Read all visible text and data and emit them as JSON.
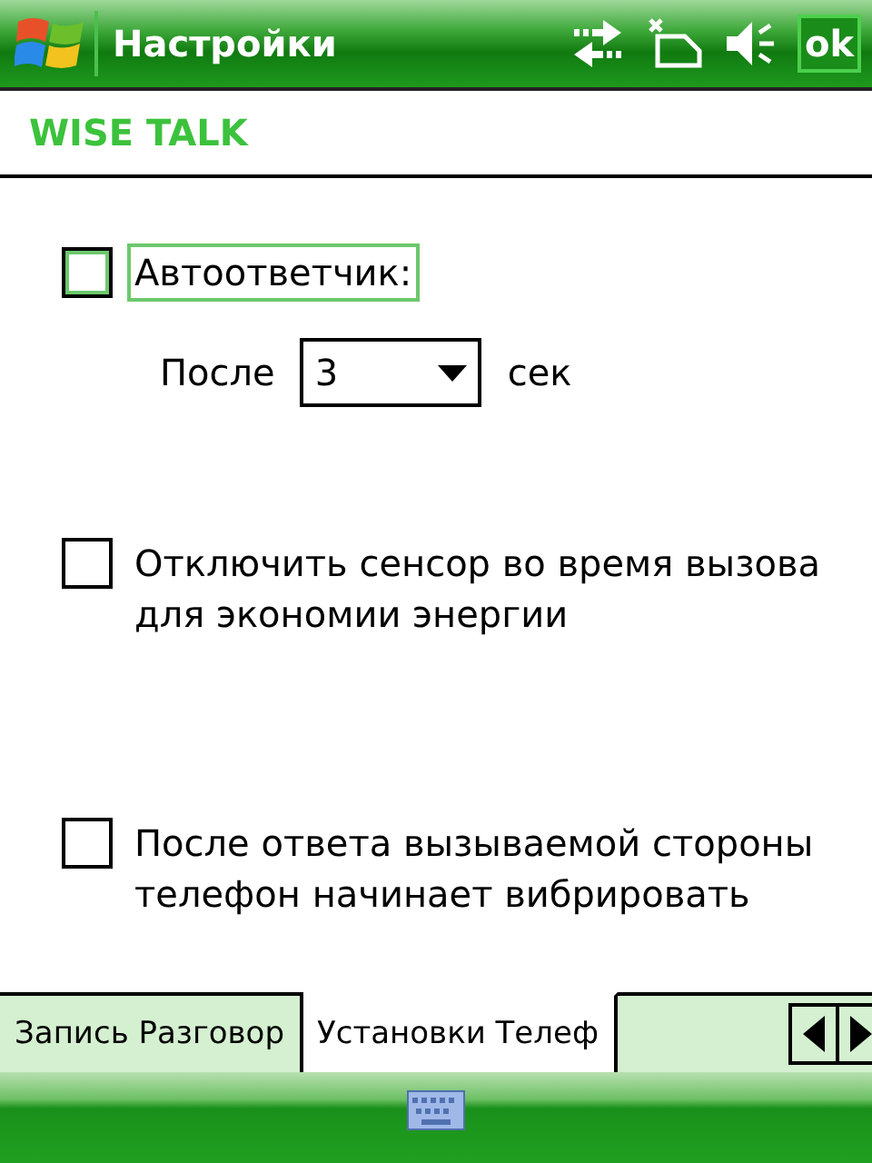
{
  "window": {
    "title": "Настройки",
    "ok_button": "ok"
  },
  "header": "WISE TALK",
  "options": [
    {
      "kind": "checkbox",
      "label": "Автоответчик:",
      "checked": false,
      "focused": true
    },
    {
      "kind": "delay",
      "prefix": "После",
      "value": "3",
      "suffix": "сек"
    },
    {
      "kind": "checkbox",
      "label": "Отключить сенсор во время вызова для экономии энергии",
      "checked": false,
      "focused": false
    },
    {
      "kind": "checkbox",
      "label": "После ответа вызываемой стороны телефон начинает вибрировать",
      "checked": false,
      "focused": false
    }
  ],
  "tabs": [
    {
      "label": "Запись Разговор",
      "selected": false
    },
    {
      "label": "Установки Телеф",
      "selected": true
    }
  ]
}
